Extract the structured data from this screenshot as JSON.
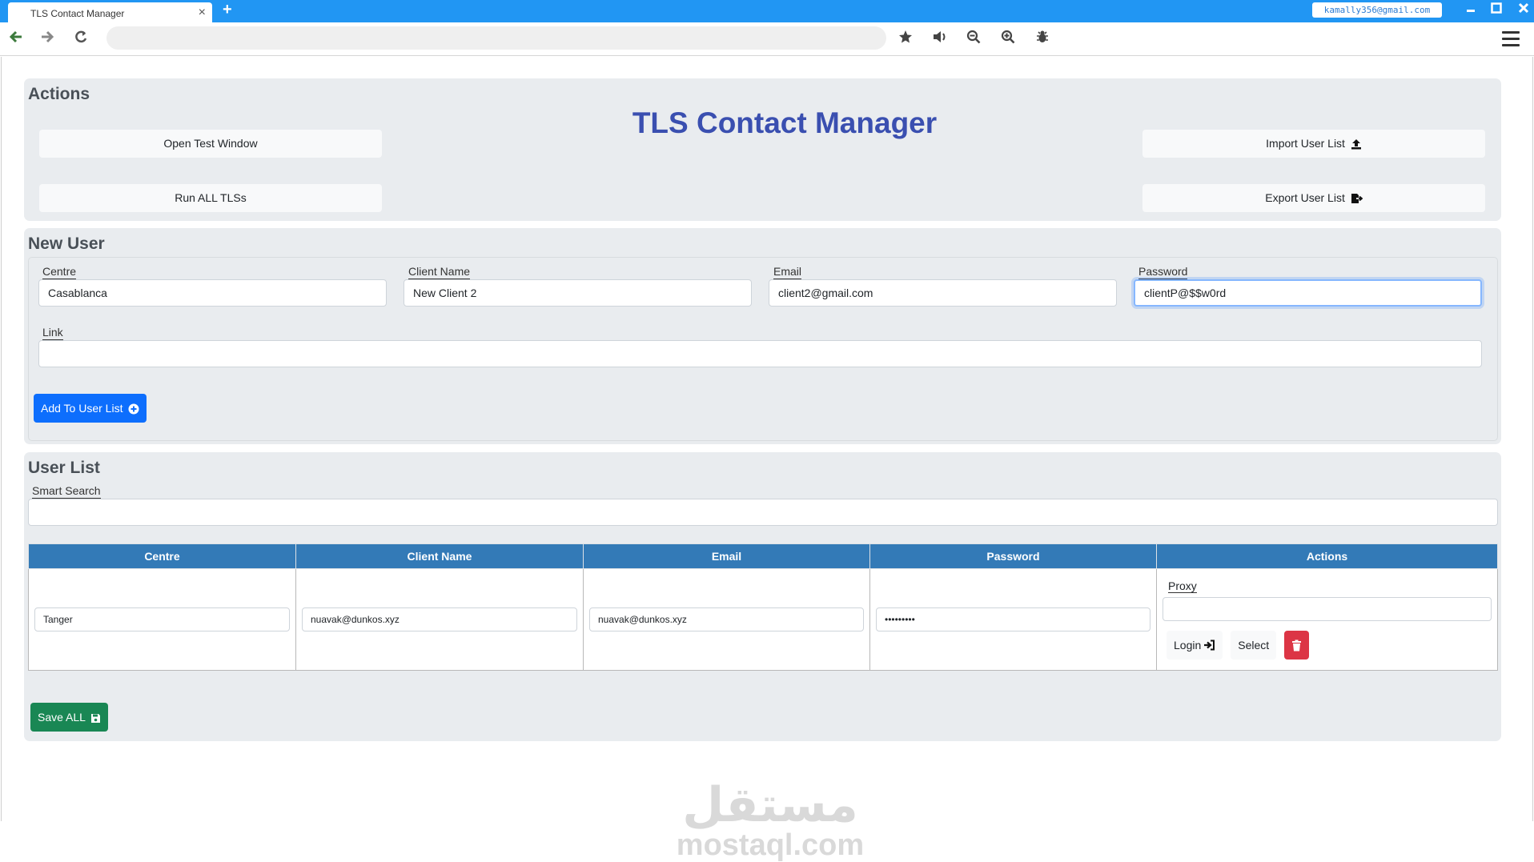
{
  "browser": {
    "tab_title": "TLS Contact Manager",
    "tab_close": "×",
    "new_tab": "+",
    "account_email": "kamally356@gmail.com",
    "url": ""
  },
  "app": {
    "title": "TLS Contact Manager"
  },
  "actions": {
    "heading": "Actions",
    "open_test_window": "Open Test Window",
    "run_all": "Run ALL TLSs",
    "import_list": "Import User List",
    "export_list": "Export User List"
  },
  "new_user": {
    "heading": "New User",
    "centre_label": "Centre",
    "centre_value": "Casablanca",
    "client_name_label": "Client Name",
    "client_name_value": "New Client 2",
    "email_label": "Email",
    "email_value": "client2@gmail.com",
    "password_label": "Password",
    "password_value": "clientP@$$w0rd",
    "link_label": "Link",
    "link_value": "",
    "add_button": "Add To User List"
  },
  "user_list": {
    "heading": "User List",
    "search_label": "Smart Search",
    "search_value": "",
    "columns": [
      "Centre",
      "Client Name",
      "Email",
      "Password",
      "Actions"
    ],
    "rows": [
      {
        "centre": "Tanger",
        "client_name": "nuavak@dunkos.xyz",
        "email": "nuavak@dunkos.xyz",
        "password": "•••••••••",
        "proxy_label": "Proxy",
        "proxy_value": "",
        "login_label": "Login",
        "select_label": "Select"
      }
    ],
    "save_all": "Save ALL"
  },
  "watermark": {
    "arabic": "مستقل",
    "latin": "mostaql.com"
  },
  "colors": {
    "chrome_blue": "#2196f3",
    "title_blue": "#3a4fb0",
    "table_header": "#337ab7",
    "primary": "#0d6efd",
    "success": "#198754",
    "danger": "#dc3545",
    "card_bg": "#e9ecef"
  },
  "icons": [
    "back-icon",
    "forward-icon",
    "reload-icon",
    "star-icon",
    "speaker-icon",
    "zoom-out-icon",
    "zoom-in-icon",
    "bug-icon",
    "menu-icon",
    "upload-icon",
    "export-icon",
    "plus-circle-icon",
    "sign-in-icon",
    "trash-icon",
    "save-icon"
  ]
}
